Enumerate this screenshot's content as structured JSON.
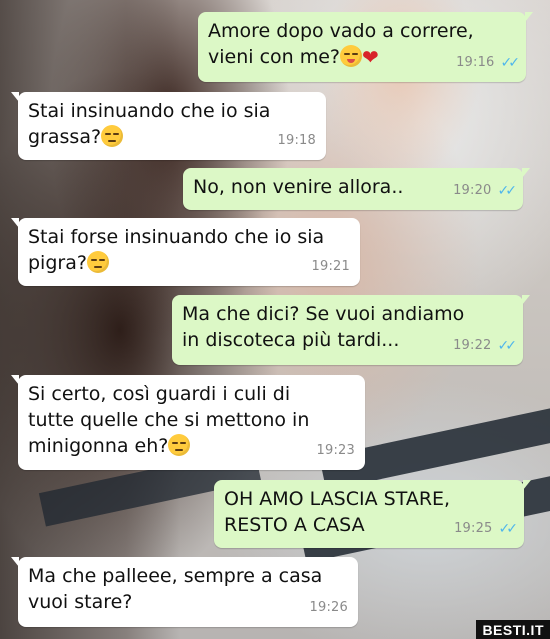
{
  "messages": [
    {
      "dir": "out",
      "lines": "Amore dopo vado a correre,\nvieni con me?",
      "emoji": [
        "tongue-wink-emoji",
        "red-heart-emoji"
      ],
      "time": "19:16",
      "read": true
    },
    {
      "dir": "in",
      "lines": "Stai insinuando che io sia\ngrassa?",
      "emoji": [
        "unamused-emoji"
      ],
      "time": "19:18"
    },
    {
      "dir": "out",
      "lines": "No, non venire allora..",
      "time": "19:20",
      "read": true
    },
    {
      "dir": "in",
      "lines": "Stai forse insinuando che io sia\npigra?",
      "emoji": [
        "unamused-emoji"
      ],
      "time": "19:21"
    },
    {
      "dir": "out",
      "lines": "Ma che dici? Se vuoi andiamo\nin discoteca più tardi...",
      "time": "19:22",
      "read": true
    },
    {
      "dir": "in",
      "lines": "Si certo, così guardi i culi di\ntutte quelle che si mettono in\nminigonna eh?",
      "emoji": [
        "unamused-emoji"
      ],
      "time": "19:23"
    },
    {
      "dir": "out",
      "lines": "OH AMO LASCIA STARE,\nRESTO A CASA",
      "time": "19:25",
      "read": true
    },
    {
      "dir": "in",
      "lines": "Ma che palleee, sempre a casa\nvuoi stare?",
      "time": "19:26"
    }
  ],
  "read_ticks": "✓✓",
  "heart_glyph": "❤",
  "watermark": "BESTI.IT",
  "colors": {
    "incoming_bubble": "#ffffff",
    "outgoing_bubble": "#dcf8c6",
    "read_ticks": "#4fb6ec"
  }
}
